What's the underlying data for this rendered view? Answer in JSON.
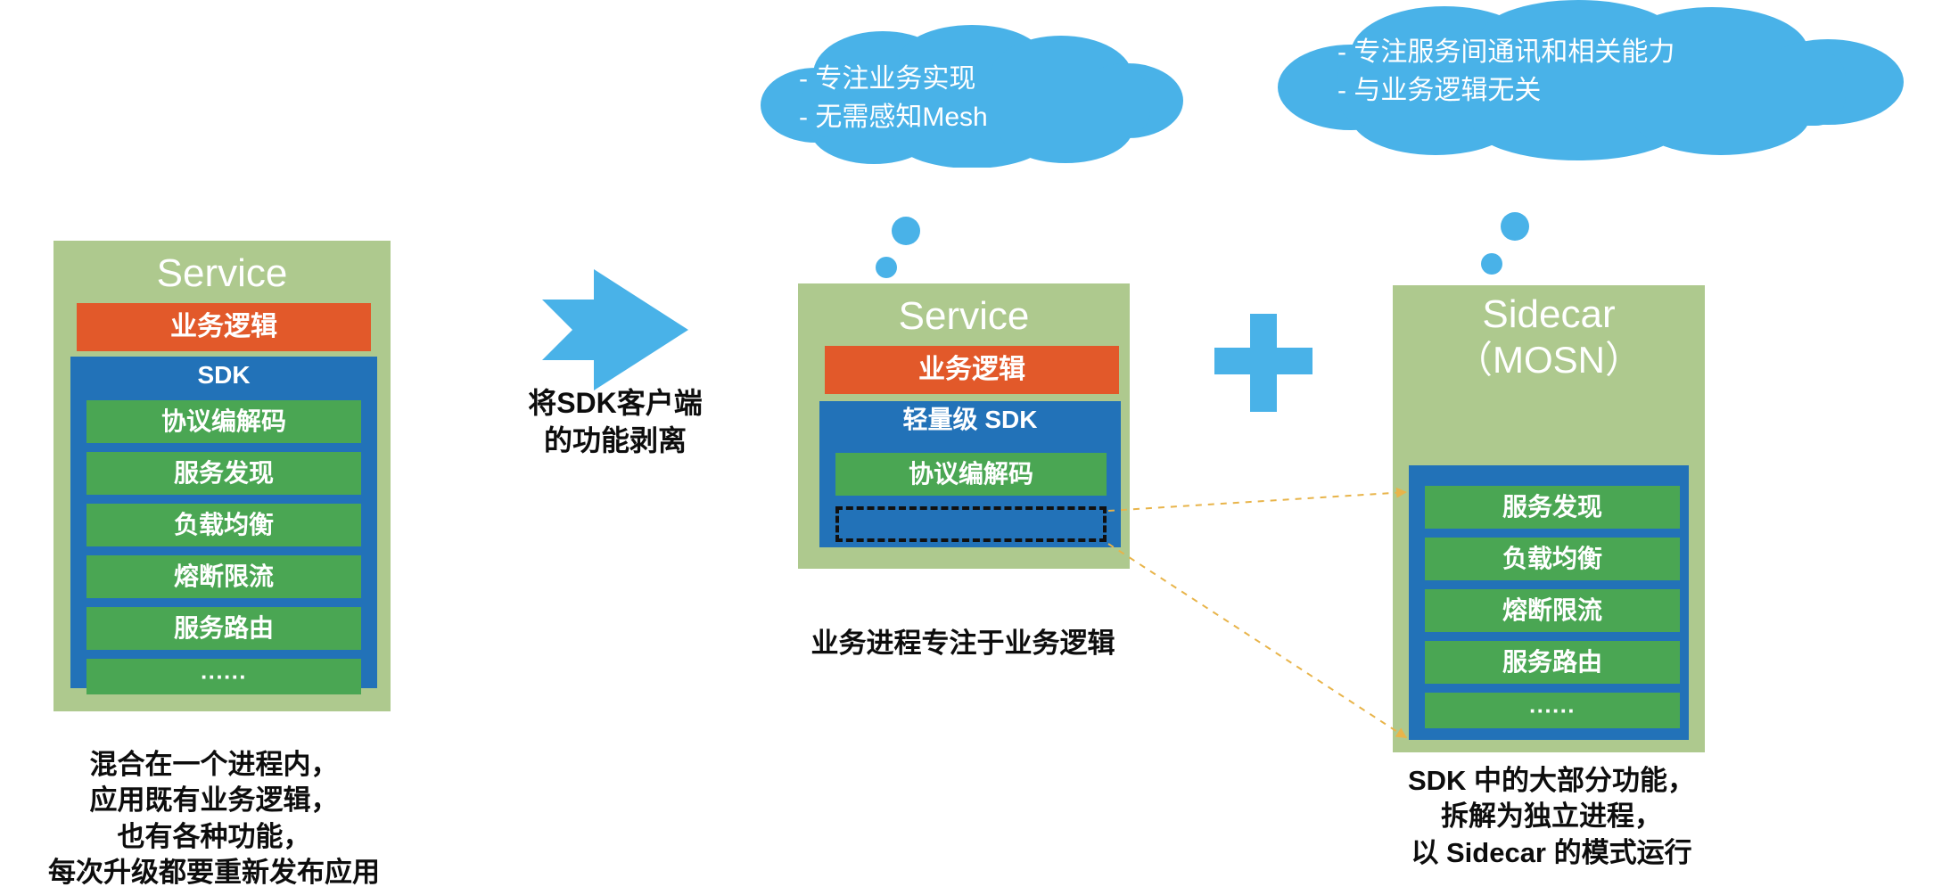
{
  "diagram": {
    "title_semantic": "service-mesh-sdk-to-sidecar-migration",
    "colors": {
      "service_green": "#aec98e",
      "business_orange": "#e2592a",
      "sdk_blue": "#2272b8",
      "capability_green": "#4aa653",
      "cloud_blue": "#49b2e8",
      "arrow_blue": "#49b2e8",
      "connector_orange": "#e8b44a",
      "caption_black": "#0d0d0d"
    }
  },
  "left_service": {
    "title": "Service",
    "business_logic": "业务逻辑",
    "sdk_title": "SDK",
    "features": [
      "协议编解码",
      "服务发现",
      "负载均衡",
      "熔断限流",
      "服务路由",
      "······"
    ],
    "caption": "混合在一个进程内，\n应用既有业务逻辑，\n也有各种功能，\n每次升级都要重新发布应用"
  },
  "transition": {
    "arrow_icon": "arrow-right-icon",
    "label": "将SDK客户端\n的功能剥离"
  },
  "cloud_service": {
    "icon": "thought-cloud-icon",
    "lines": "-   专注业务实现\n-   无需感知Mesh"
  },
  "cloud_sidecar": {
    "icon": "thought-cloud-icon",
    "lines": "-   专注服务间通讯和相关能力\n-   与业务逻辑无关"
  },
  "mid_service": {
    "title": "Service",
    "business_logic": "业务逻辑",
    "sdk_title": "轻量级 SDK",
    "features": [
      "协议编解码"
    ],
    "placeholder_label": "",
    "caption": "业务进程专注于业务逻辑"
  },
  "plus": {
    "icon": "plus-icon",
    "label": "+"
  },
  "sidecar": {
    "title_line1": "Sidecar",
    "title_line2": "（MOSN）",
    "features": [
      "服务发现",
      "负载均衡",
      "熔断限流",
      "服务路由",
      "······"
    ],
    "caption": "SDK 中的大部分功能，\n拆解为独立进程，\n以 Sidecar 的模式运行"
  }
}
